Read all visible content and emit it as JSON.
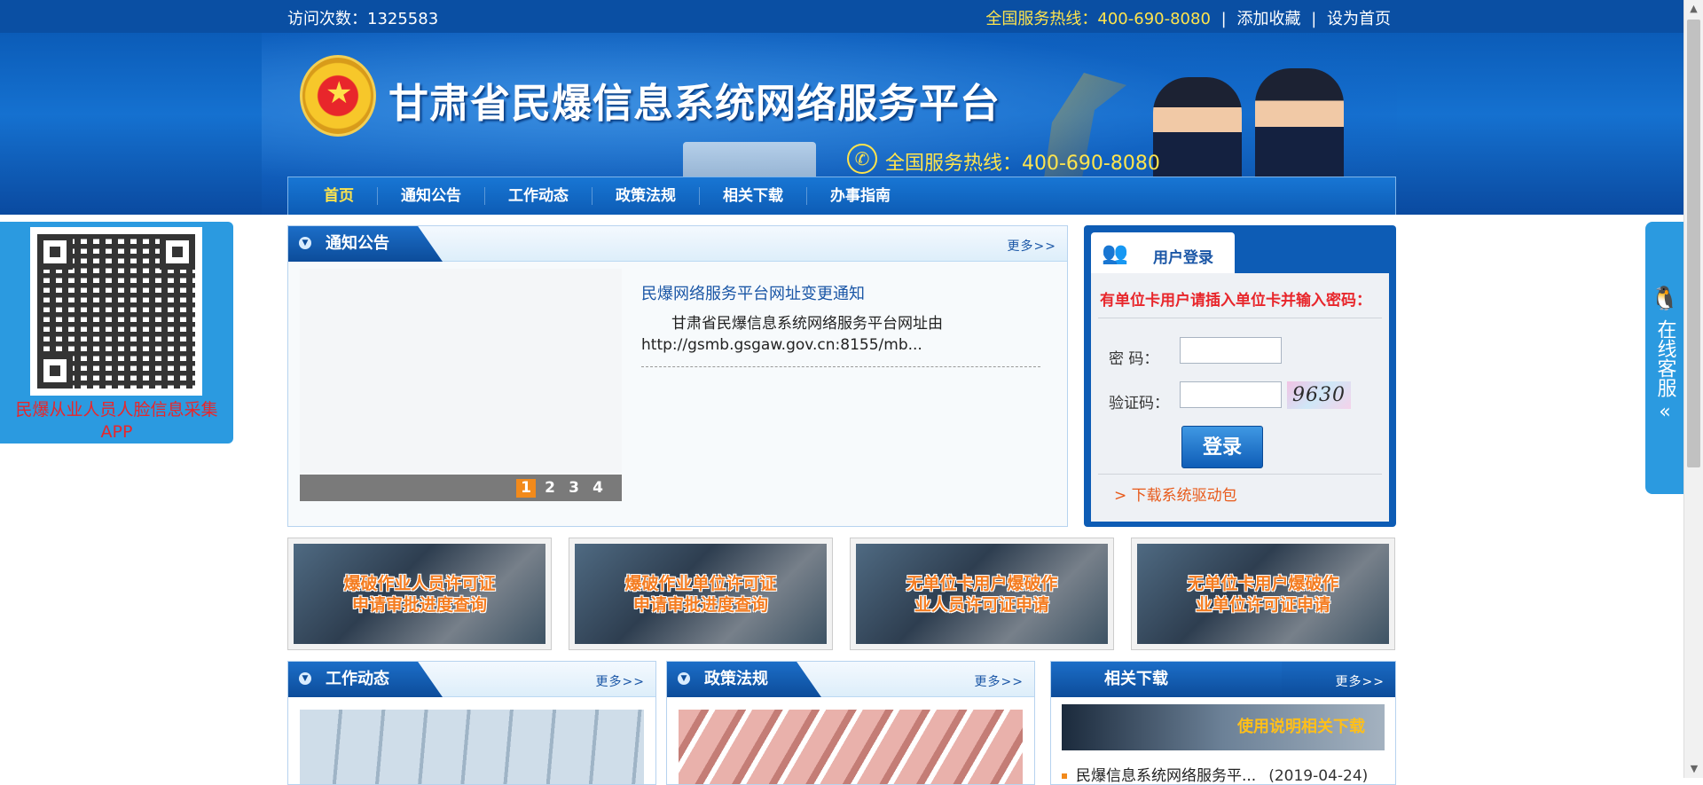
{
  "topbar": {
    "visits_label": "访问次数：1325583",
    "hotline": "全国服务热线：400-690-8080",
    "add_favorite": "添加收藏",
    "set_homepage": "设为首页",
    "separator": "|"
  },
  "banner": {
    "title": "甘肃省民爆信息系统网络服务平台",
    "hotline": "全国服务热线：400-690-8080",
    "emblem_icon": "police-emblem-icon",
    "phone_icon": "phone-icon"
  },
  "nav": {
    "items": [
      "首页",
      "通知公告",
      "工作动态",
      "政策法规",
      "相关下载",
      "办事指南"
    ],
    "active": "首页"
  },
  "qr_panel": {
    "caption": "民爆从业人员人脸信息采集APP"
  },
  "service": {
    "label": "在线客服",
    "icon": "qq-penguin-icon",
    "arrow": "«"
  },
  "notice": {
    "heading": "通知公告",
    "more": "更多>>",
    "title": "民爆网络服务平台网址变更通知",
    "excerpt": "甘肃省民爆信息系统网络服务平台网址由http://gsmb.gsgaw.gov.cn:8155/mb...",
    "slides": [
      "1",
      "2",
      "3",
      "4"
    ],
    "active_slide": "1"
  },
  "login": {
    "tab_label": "用户登录",
    "hint": "有单位卡用户请插入单位卡并输入密码：",
    "password_label": "密  码：",
    "captcha_label": "验证码：",
    "captcha_text": "9630",
    "button": "登录",
    "driver_link": "> 下载系统驱动包"
  },
  "quick_links": [
    {
      "line1": "爆破作业人员许可证",
      "line2": "申请审批进度查询"
    },
    {
      "line1": "爆破作业单位许可证",
      "line2": "申请审批进度查询"
    },
    {
      "line1": "无单位卡用户爆破作",
      "line2": "业人员许可证申请"
    },
    {
      "line1": "无单位卡用户爆破作",
      "line2": "业单位许可证申请"
    }
  ],
  "work_news": {
    "heading": "工作动态",
    "more": "更多>>"
  },
  "policy": {
    "heading": "政策法规",
    "more": "更多>>"
  },
  "downloads": {
    "heading": "相关下载",
    "more": "更多>>",
    "banner_text": "使用说明相关下载",
    "items": [
      {
        "title": "民爆信息系统网络服务平...",
        "date": "(2019-04-24)"
      }
    ]
  },
  "colors": {
    "primary_blue": "#0a4fa3",
    "hotline_yellow": "#ffe44d",
    "alert_red": "#e8262b",
    "accent_orange": "#f28a1b"
  }
}
